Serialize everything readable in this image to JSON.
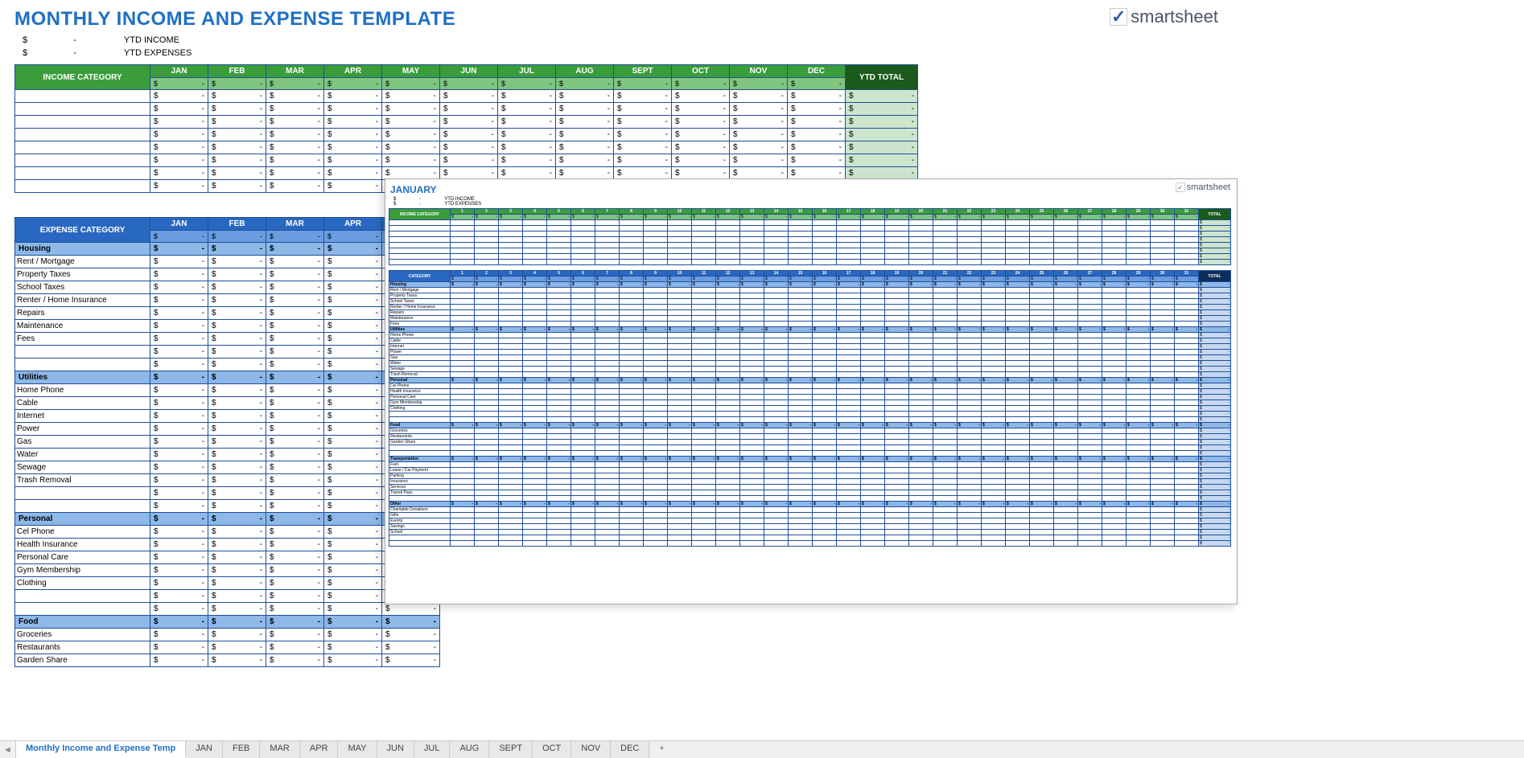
{
  "title": "MONTHLY INCOME AND EXPENSE TEMPLATE",
  "brand": "smartsheet",
  "ytd": {
    "income_sym": "$",
    "income_dash": "-",
    "income_label": "YTD INCOME",
    "exp_sym": "$",
    "exp_dash": "-",
    "exp_label": "YTD EXPENSES"
  },
  "months": [
    "JAN",
    "FEB",
    "MAR",
    "APR",
    "MAY",
    "JUN",
    "JUL",
    "AUG",
    "SEPT",
    "OCT",
    "NOV",
    "DEC"
  ],
  "income_header": "INCOME CATEGORY",
  "expense_header": "EXPENSE CATEGORY",
  "ytd_total": "YTD TOTAL",
  "dollar": "$",
  "dash": "-",
  "income_rows": [
    "",
    "",
    "",
    "",
    "",
    "",
    "",
    ""
  ],
  "expense_groups": [
    {
      "name": "Housing",
      "items": [
        "Rent / Mortgage",
        "Property Taxes",
        "School Taxes",
        "Renter / Home Insurance",
        "Repairs",
        "Maintenance",
        "Fees",
        "",
        ""
      ]
    },
    {
      "name": "Utilities",
      "items": [
        "Home Phone",
        "Cable",
        "Internet",
        "Power",
        "Gas",
        "Water",
        "Sewage",
        "Trash Removal",
        "",
        ""
      ]
    },
    {
      "name": "Personal",
      "items": [
        "Cel Phone",
        "Health Insurance",
        "Personal Care",
        "Gym Membership",
        "Clothing",
        "",
        ""
      ]
    },
    {
      "name": "Food",
      "items": [
        "Groceries",
        "Restaurants",
        "Garden Share"
      ]
    }
  ],
  "overlay": {
    "title": "JANUARY",
    "ytd_income": "YTD INCOME",
    "ytd_exp": "YTD EXPENSES",
    "income_header": "INCOME CATEGORY",
    "category_header": "CATEGORY",
    "total": "TOTAL",
    "days": [
      "1",
      "2",
      "3",
      "4",
      "5",
      "6",
      "7",
      "8",
      "9",
      "10",
      "11",
      "12",
      "13",
      "14",
      "15",
      "16",
      "17",
      "18",
      "19",
      "20",
      "21",
      "22",
      "23",
      "24",
      "25",
      "26",
      "27",
      "28",
      "29",
      "30",
      "31"
    ],
    "income_rows": [
      "",
      "",
      "",
      "",
      "",
      "",
      "",
      ""
    ],
    "groups": [
      {
        "name": "Housing",
        "items": [
          "Rent / Mortgage",
          "Property Taxes",
          "School Taxes",
          "Renter / Home Insurance",
          "Repairs",
          "Maintenance",
          "Fees"
        ]
      },
      {
        "name": "Utilities",
        "items": [
          "Home Phone",
          "Cable",
          "Internet",
          "Power",
          "Gas",
          "Water",
          "Sewage",
          "Trash Removal"
        ]
      },
      {
        "name": "Personal",
        "items": [
          "Cel Phone",
          "Health Insurance",
          "Personal Care",
          "Gym Membership",
          "Clothing",
          "",
          ""
        ]
      },
      {
        "name": "Food",
        "items": [
          "Groceries",
          "Restaurants",
          "Garden Share",
          "",
          ""
        ]
      },
      {
        "name": "Transportation",
        "items": [
          "Fuel",
          "Lease / Car Payment",
          "Parking",
          "Insurance",
          "Services",
          "Transit Pass",
          ""
        ]
      },
      {
        "name": "Other",
        "items": [
          "Charitable Donations",
          "Gifts",
          "Events",
          "Savings",
          "School",
          "",
          ""
        ]
      }
    ]
  },
  "tabs": {
    "active": "Monthly Income and Expense Temp",
    "list": [
      "JAN",
      "FEB",
      "MAR",
      "APR",
      "MAY",
      "JUN",
      "JUL",
      "AUG",
      "SEPT",
      "OCT",
      "NOV",
      "DEC"
    ],
    "add": "+"
  }
}
